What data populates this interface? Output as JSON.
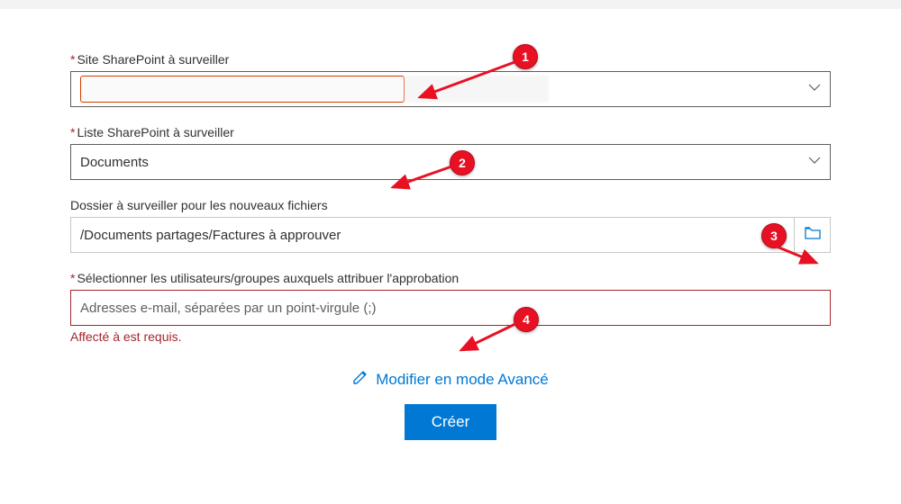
{
  "fields": {
    "site": {
      "label": "Site SharePoint à surveiller",
      "value": ""
    },
    "list": {
      "label": "Liste SharePoint à surveiller",
      "value": "Documents"
    },
    "folder": {
      "label": "Dossier à surveiller pour les nouveaux fichiers",
      "value": "/Documents partages/Factures à approuver"
    },
    "users": {
      "label": "Sélectionner les utilisateurs/groupes auxquels attribuer l'approbation",
      "placeholder": "Adresses e-mail, séparées par un point-virgule (;)",
      "error": "Affecté à est requis."
    }
  },
  "actions": {
    "advanced_label": "Modifier en mode Avancé",
    "create_label": "Créer"
  },
  "callouts": {
    "c1": "1",
    "c2": "2",
    "c3": "3",
    "c4": "4"
  }
}
